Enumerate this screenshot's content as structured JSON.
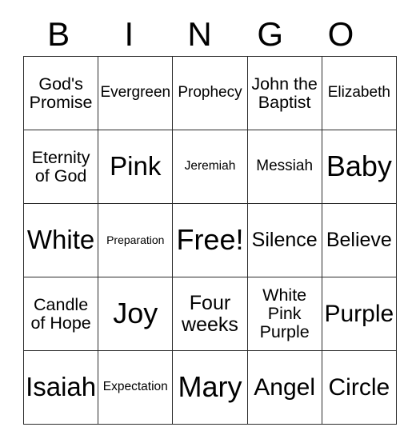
{
  "card": {
    "type": "bingo-card",
    "columns": 5,
    "rows": 5,
    "theme_colors": {
      "background": "#ffffff",
      "text": "#000000",
      "border": "#2b2b2b"
    }
  },
  "header": {
    "letters": [
      {
        "label": "B"
      },
      {
        "label": "I"
      },
      {
        "label": "N"
      },
      {
        "label": "G"
      },
      {
        "label": "O"
      }
    ]
  },
  "grid": {
    "rows": [
      {
        "cells": [
          {
            "text": "God's Promise",
            "size": "fs-ml",
            "free": false
          },
          {
            "text": "Evergreen",
            "size": "fs-m",
            "free": false
          },
          {
            "text": "Prophecy",
            "size": "fs-m",
            "free": false
          },
          {
            "text": "John the Baptist",
            "size": "fs-ml",
            "free": false
          },
          {
            "text": "Elizabeth",
            "size": "fs-m",
            "free": false
          }
        ]
      },
      {
        "cells": [
          {
            "text": "Eternity of God",
            "size": "fs-ml",
            "free": false
          },
          {
            "text": "Pink",
            "size": "fs-xxl",
            "free": false
          },
          {
            "text": "Jeremiah",
            "size": "fs-s",
            "free": false
          },
          {
            "text": "Messiah",
            "size": "fs-m",
            "free": false
          },
          {
            "text": "Baby",
            "size": "fs-3xl",
            "free": false
          }
        ]
      },
      {
        "cells": [
          {
            "text": "White",
            "size": "fs-xxl",
            "free": false
          },
          {
            "text": "Preparation",
            "size": "fs-xs",
            "free": false
          },
          {
            "text": "Free!",
            "size": "fs-3xl",
            "free": true
          },
          {
            "text": "Silence",
            "size": "fs-l",
            "free": false
          },
          {
            "text": "Believe",
            "size": "fs-l",
            "free": false
          }
        ]
      },
      {
        "cells": [
          {
            "text": "Candle of Hope",
            "size": "fs-ml",
            "free": false
          },
          {
            "text": "Joy",
            "size": "fs-3xl",
            "free": false
          },
          {
            "text": "Four weeks",
            "size": "fs-l",
            "free": false
          },
          {
            "text": "White Pink Purple",
            "size": "fs-ml",
            "free": false
          },
          {
            "text": "Purple",
            "size": "fs-xl",
            "free": false
          }
        ]
      },
      {
        "cells": [
          {
            "text": "Isaiah",
            "size": "fs-xxl",
            "free": false
          },
          {
            "text": "Expectation",
            "size": "fs-s",
            "free": false
          },
          {
            "text": "Mary",
            "size": "fs-3xl",
            "free": false
          },
          {
            "text": "Angel",
            "size": "fs-xl",
            "free": false
          },
          {
            "text": "Circle",
            "size": "fs-xl",
            "free": false
          }
        ]
      }
    ]
  }
}
